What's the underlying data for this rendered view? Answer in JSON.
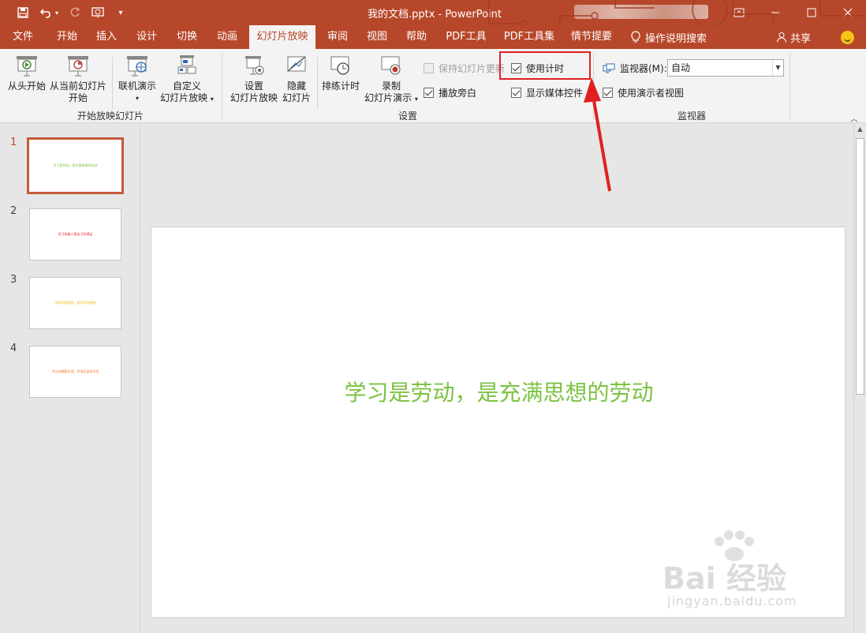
{
  "window": {
    "title": "我的文档.pptx  -  PowerPoint",
    "accent_color": "#b7472a"
  },
  "qat": {
    "icons": [
      "save-icon",
      "undo-icon",
      "redo-icon",
      "from-beginning-icon",
      "customize-qat-icon"
    ]
  },
  "tabs": [
    {
      "label": "文件"
    },
    {
      "label": "开始"
    },
    {
      "label": "插入"
    },
    {
      "label": "设计"
    },
    {
      "label": "切换"
    },
    {
      "label": "动画"
    },
    {
      "label": "幻灯片放映"
    },
    {
      "label": "审阅"
    },
    {
      "label": "视图"
    },
    {
      "label": "帮助"
    },
    {
      "label": "PDF工具"
    },
    {
      "label": "PDF工具集"
    },
    {
      "label": "情节提要"
    }
  ],
  "active_tab": "幻灯片放映",
  "tell_me": "操作说明搜索",
  "share": "共享",
  "ribbon": {
    "start_group": {
      "label": "开始放映幻灯片",
      "from_beginning": "从头开始",
      "from_current_1": "从当前幻灯片",
      "from_current_2": "开始",
      "online_1": "联机演示",
      "custom_1": "自定义",
      "custom_2": "幻灯片放映"
    },
    "setup_group": {
      "label": "设置",
      "setup_1": "设置",
      "setup_2": "幻灯片放映",
      "hide_1": "隐藏",
      "hide_2": "幻灯片",
      "rehearse": "排练计时",
      "record_1": "录制",
      "record_2": "幻灯片演示",
      "keep_updated": "保持幻灯片更新",
      "play_narration": "播放旁白",
      "use_timings": "使用计时",
      "show_media_controls": "显示媒体控件"
    },
    "monitor_group": {
      "label": "监视器",
      "monitor_label": "监视器(M):",
      "monitor_value": "自动",
      "presenter_view": "使用演示者视图"
    }
  },
  "slides": [
    {
      "number": "1",
      "text": "学习是劳动，是充满思想的劳动",
      "color": "#7cc242"
    },
    {
      "number": "2",
      "text": "学习的敌人是自己的满足",
      "color": "#e02020"
    },
    {
      "number": "3",
      "text": "学而不思则罔，思而不学则殆",
      "color": "#f0b400"
    },
    {
      "number": "4",
      "text": "书山有路勤为径，学海无涯苦作舟",
      "color": "#f07020"
    }
  ],
  "current_slide": {
    "text": "学习是劳动，是充满思想的劳动"
  },
  "watermark": {
    "main": "Bai 经验",
    "sub": "jingyan.baidu.com"
  }
}
